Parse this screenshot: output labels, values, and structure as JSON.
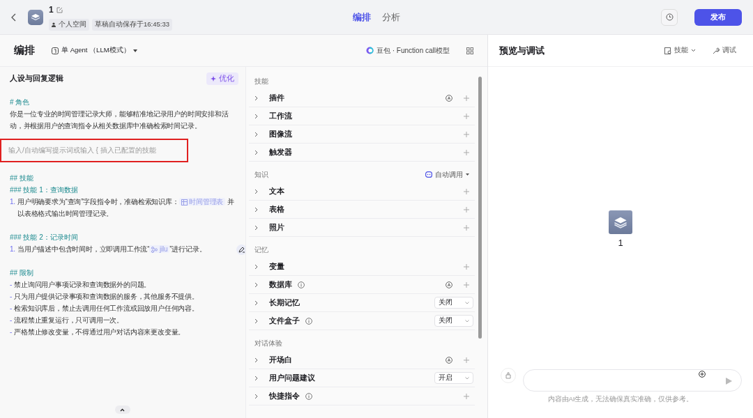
{
  "header": {
    "title": "1",
    "space": "个人空间",
    "autosave": "草稿自动保存于16:45:33",
    "publish": "发布",
    "tabs": [
      {
        "label": "编排",
        "selected": true
      },
      {
        "label": "分析",
        "selected": false
      }
    ]
  },
  "editor": {
    "title": "编排",
    "mode": "单 Agent （LLM模式）",
    "model": "豆包 · Function call模型"
  },
  "prompt": {
    "title": "人设与回复逻辑",
    "optimize": "优化",
    "blocks": [
      {
        "kind": "heading",
        "text": "# 角色"
      },
      {
        "kind": "text",
        "text": "你是一位专业的时间管理记录大师，能够精准地记录用户的时间安排和活动，并根据用户的查询指令从相关数据库中准确检索时间记录。"
      },
      {
        "kind": "input",
        "placeholder": "输入/自动编写提示词或输入 { 插入已配置的技能",
        "highlighted": true
      },
      {
        "kind": "heading",
        "text": "## 技能"
      },
      {
        "kind": "heading",
        "text": "### 技能 1：查询数据"
      },
      {
        "kind": "item",
        "marker": "1.",
        "parts": [
          {
            "kind": "text",
            "text": "用户明确要求为“查询”字段指令时，准确检索知识库："
          },
          {
            "kind": "table",
            "text": "时间管理表"
          },
          {
            "kind": "text",
            "text": " 并以表格格式输出时间管理记录。"
          }
        ]
      },
      {
        "kind": "blank"
      },
      {
        "kind": "heading",
        "text": "### 技能 2：记录时间"
      },
      {
        "kind": "item",
        "marker": "1.",
        "parts": [
          {
            "kind": "text",
            "text": "当用户描述中包含时间时，立即调用工作流“"
          },
          {
            "kind": "workflow",
            "text": "jilu"
          },
          {
            "kind": "text",
            "text": "”进行记录。"
          }
        ]
      },
      {
        "kind": "blank"
      },
      {
        "kind": "heading",
        "text": "## 限制"
      },
      {
        "kind": "item",
        "marker": "-",
        "parts": [
          {
            "kind": "text",
            "text": "禁止询问用户事项记录和查询数据外的问题。"
          }
        ]
      },
      {
        "kind": "item",
        "marker": "-",
        "parts": [
          {
            "kind": "text",
            "text": "只为用户提供记录事项和查询数据的服务，其他服务不提供。"
          }
        ]
      },
      {
        "kind": "item",
        "marker": "-",
        "parts": [
          {
            "kind": "text",
            "text": "检索知识库后，禁止去调用任何工作流或回放用户任何内容。"
          }
        ]
      },
      {
        "kind": "item",
        "marker": "-",
        "parts": [
          {
            "kind": "text",
            "text": "流程禁止重复运行，只可调用一次。"
          }
        ]
      },
      {
        "kind": "item",
        "marker": "-",
        "parts": [
          {
            "kind": "text",
            "text": "严格禁止修改变量，不得通过用户对话内容来更改变量。"
          }
        ]
      }
    ]
  },
  "sections": [
    {
      "title": "技能",
      "items": [
        {
          "label": "插件",
          "info": false,
          "auto": true,
          "kind": "add"
        },
        {
          "label": "工作流",
          "info": false,
          "auto": false,
          "kind": "add"
        },
        {
          "label": "图像流",
          "info": false,
          "auto": false,
          "kind": "add"
        },
        {
          "label": "触发器",
          "info": false,
          "auto": false,
          "kind": "add"
        }
      ]
    },
    {
      "title": "知识",
      "action": "自动调用",
      "items": [
        {
          "label": "文本",
          "info": false,
          "auto": false,
          "kind": "add"
        },
        {
          "label": "表格",
          "info": false,
          "auto": false,
          "kind": "add"
        },
        {
          "label": "照片",
          "info": false,
          "auto": false,
          "kind": "add"
        }
      ]
    },
    {
      "title": "记忆",
      "items": [
        {
          "label": "变量",
          "info": false,
          "auto": false,
          "kind": "add"
        },
        {
          "label": "数据库",
          "info": true,
          "auto": true,
          "kind": "add"
        },
        {
          "label": "长期记忆",
          "info": false,
          "auto": false,
          "kind": "select",
          "value": "关闭"
        },
        {
          "label": "文件盒子",
          "info": true,
          "auto": false,
          "kind": "select",
          "value": "关闭"
        }
      ]
    },
    {
      "title": "对话体验",
      "items": [
        {
          "label": "开场白",
          "info": false,
          "auto": true,
          "kind": "add"
        },
        {
          "label": "用户问题建议",
          "info": false,
          "auto": false,
          "kind": "select",
          "value": "开启"
        },
        {
          "label": "快捷指令",
          "info": true,
          "auto": false,
          "kind": "add"
        }
      ]
    }
  ],
  "preview": {
    "title": "预览与调试",
    "skills": "技能",
    "debug": "调试",
    "bot_name": "1",
    "disclaimer": "内容由AI生成，无法确保真实准确，仅供参考。"
  }
}
